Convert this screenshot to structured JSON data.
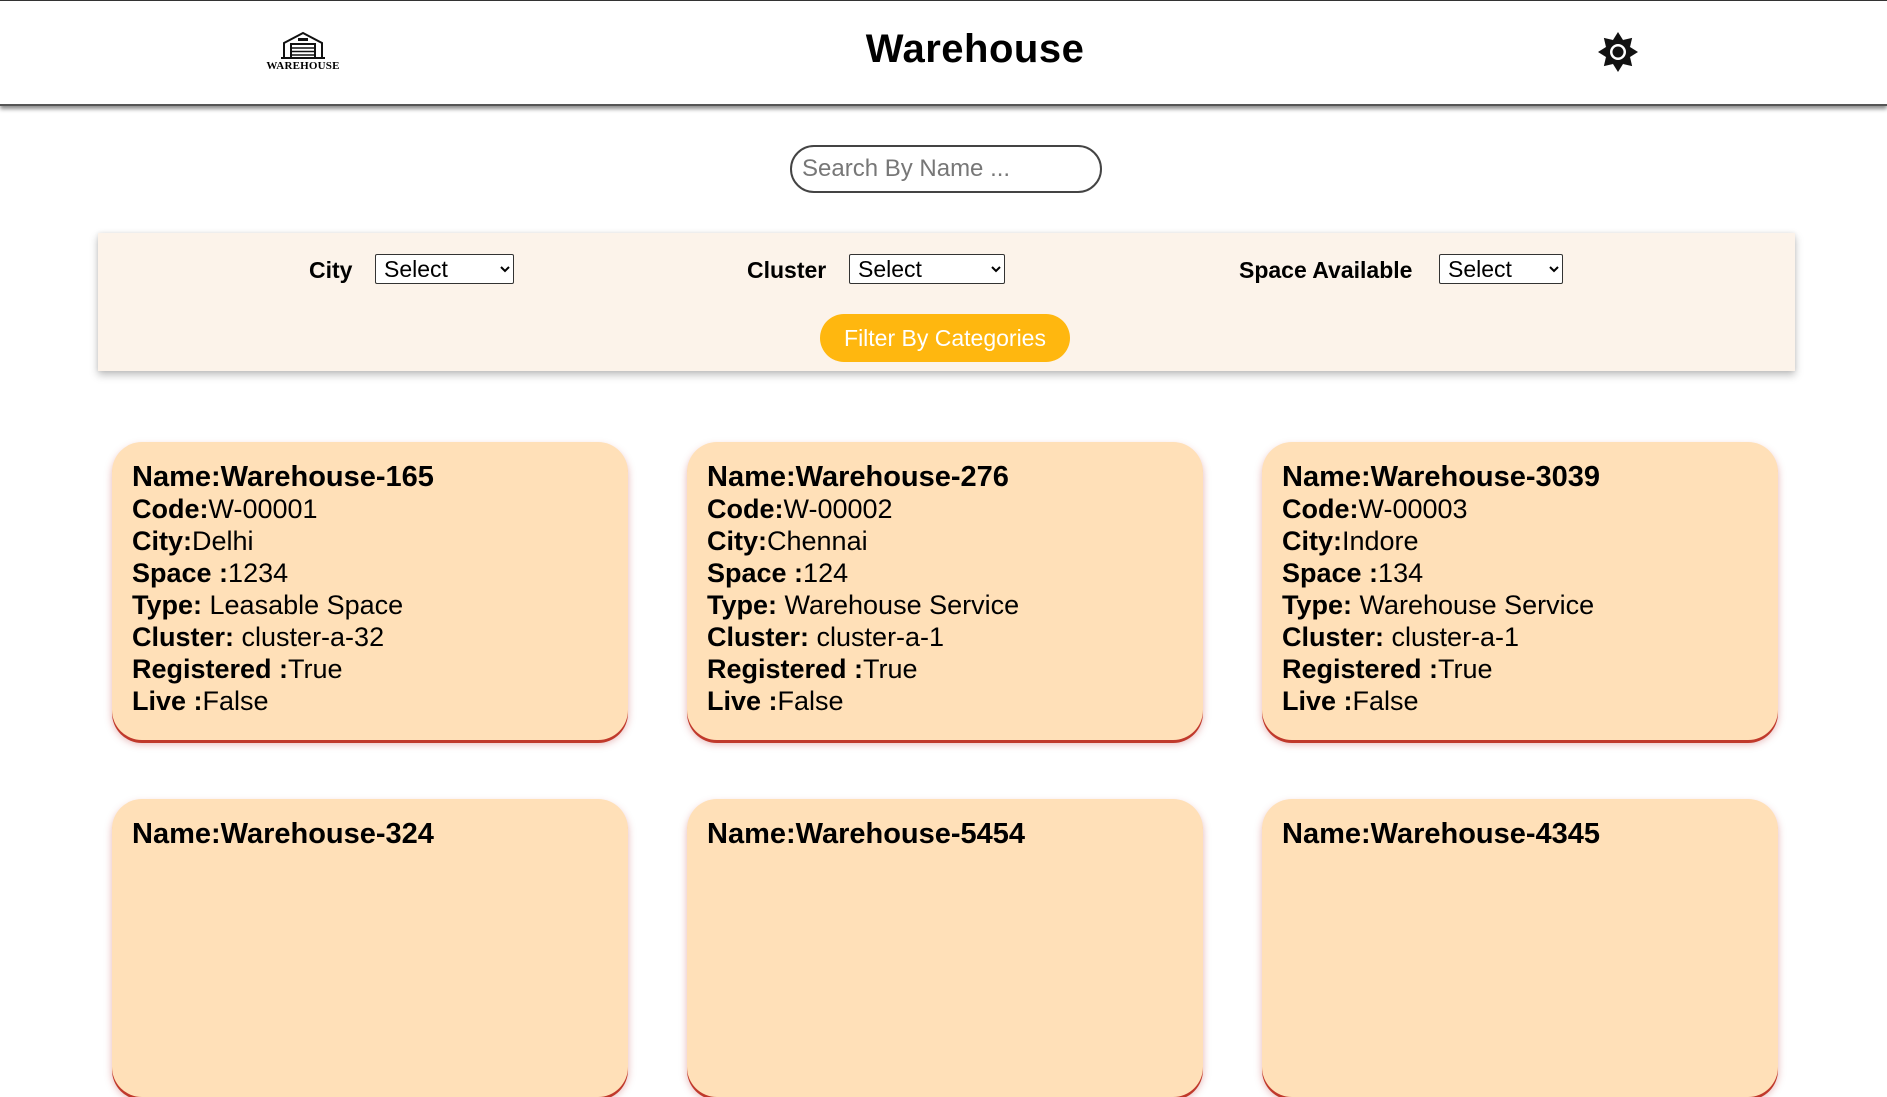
{
  "header": {
    "logo_text": "WAREHOUSE",
    "title": "Warehouse",
    "theme_icon": "sun-gear-icon"
  },
  "search": {
    "placeholder": "Search By Name ...",
    "value": ""
  },
  "filters": {
    "city_label": "City",
    "city_value": "Select",
    "cluster_label": "Cluster",
    "cluster_value": "Select",
    "space_label": "Space Available",
    "space_value": "Select",
    "button_label": "Filter By Categories"
  },
  "labels": {
    "name": "Name:",
    "code": "Code:",
    "city": "City:",
    "space": "Space :",
    "type": "Type: ",
    "cluster": "Cluster: ",
    "registered": "Registered :",
    "live": "Live :"
  },
  "colors": {
    "card_bg": "#ffe0b8",
    "card_shadow": "#c0392b",
    "filter_panel_bg": "#fcf3ea",
    "button_bg": "#ffb70f"
  },
  "warehouses": [
    {
      "name": "Warehouse-165",
      "code": "W-00001",
      "city": "Delhi",
      "space": "1234",
      "type": "Leasable Space",
      "cluster": "cluster-a-32",
      "registered": "True",
      "live": "False"
    },
    {
      "name": "Warehouse-276",
      "code": "W-00002",
      "city": "Chennai",
      "space": "124",
      "type": "Warehouse Service",
      "cluster": "cluster-a-1",
      "registered": "True",
      "live": "False"
    },
    {
      "name": "Warehouse-3039",
      "code": "W-00003",
      "city": "Indore",
      "space": "134",
      "type": "Warehouse Service",
      "cluster": "cluster-a-1",
      "registered": "True",
      "live": "False"
    },
    {
      "name": "Warehouse-324"
    },
    {
      "name": "Warehouse-5454"
    },
    {
      "name": "Warehouse-4345"
    }
  ]
}
